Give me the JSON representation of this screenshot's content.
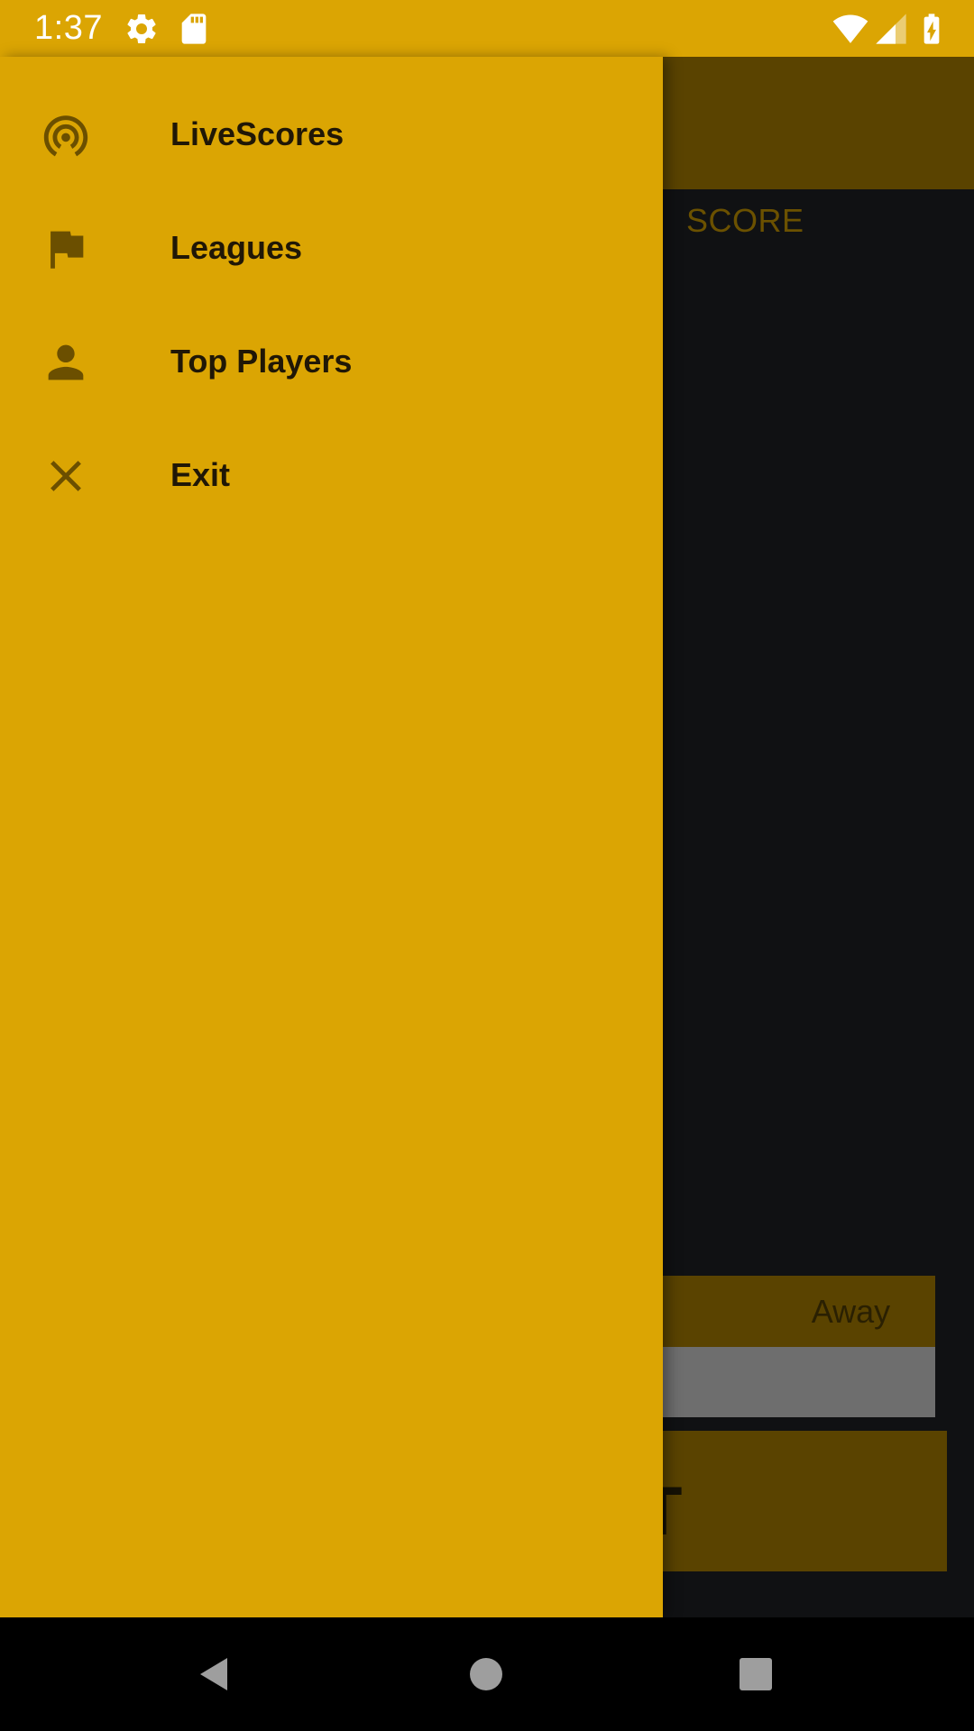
{
  "status_bar": {
    "time": "1:37",
    "icons": [
      "settings-icon",
      "sd-card-icon",
      "wifi-icon",
      "cell-signal-icon",
      "battery-charging-icon"
    ]
  },
  "background": {
    "score_header": "SCORE",
    "away_label": "Away",
    "button_text": "T"
  },
  "drawer": {
    "items": [
      {
        "label": "LiveScores",
        "icon": "livescores-icon"
      },
      {
        "label": "Leagues",
        "icon": "flag-icon"
      },
      {
        "label": "Top Players",
        "icon": "person-icon"
      },
      {
        "label": "Exit",
        "icon": "close-icon"
      }
    ]
  },
  "colors": {
    "accent": "#dba503",
    "icon": "#6b4f00",
    "text": "#201706",
    "dim_toolbar": "#5a4300"
  },
  "nav_bar": {
    "buttons": [
      "back-icon",
      "home-icon",
      "recents-icon"
    ]
  }
}
